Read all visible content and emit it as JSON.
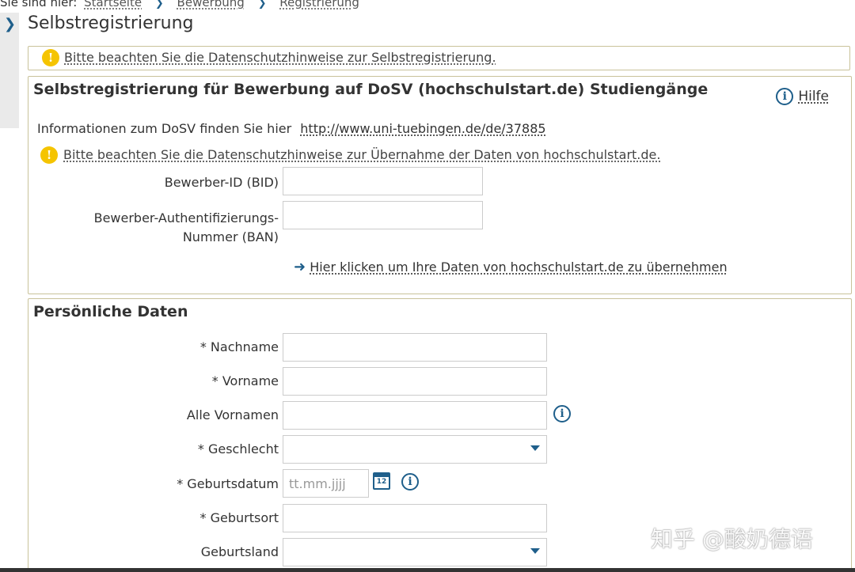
{
  "breadcrumb": {
    "prefix": "Sie sind hier:",
    "items": [
      "Startseite",
      "Bewerbung",
      "Registrierung"
    ]
  },
  "page": {
    "title": "Selbstregistrierung",
    "privacy_notice": "Bitte beachten Sie die Datenschutzhinweise zur Selbstregistrierung."
  },
  "dosv": {
    "heading": "Selbstregistrierung für Bewerbung auf DoSV (hochschulstart.de) Studiengänge",
    "help_label": "Hilfe",
    "info_text": "Informationen zum DoSV finden Sie hier",
    "info_link": "http://www.uni-tuebingen.de/de/37885",
    "privacy_notice": "Bitte beachten Sie die Datenschutzhinweise zur Übernahme der Daten von hochschulstart.de.",
    "bid_label": "Bewerber-ID (BID)",
    "ban_label_1": "Bewerber-Authentifizierungs-",
    "ban_label_2": "Nummer (BAN)",
    "import_link": "Hier klicken um Ihre Daten von hochschulstart.de zu übernehmen"
  },
  "personal": {
    "heading": "Persönliche Daten",
    "nachname": "* Nachname",
    "vorname": "* Vorname",
    "alle_vornamen": "Alle Vornamen",
    "geschlecht": "* Geschlecht",
    "geburtsdatum": "* Geburtsdatum",
    "geburtsdatum_placeholder": "tt.mm.jjjj",
    "calendar_day": "12",
    "geburtsort": "* Geburtsort",
    "geburtsland": "Geburtsland"
  },
  "watermark": "知乎 @酸奶德语",
  "icons": {
    "warning": "warning-icon",
    "info": "info-icon",
    "calendar": "calendar-icon",
    "arrow": "arrow-right-icon",
    "chevron": "chevron-right-icon",
    "dropdown": "chevron-down-icon"
  },
  "colors": {
    "accent": "#1f5f8b",
    "warning": "#f5c400",
    "border": "#c9c29a"
  }
}
